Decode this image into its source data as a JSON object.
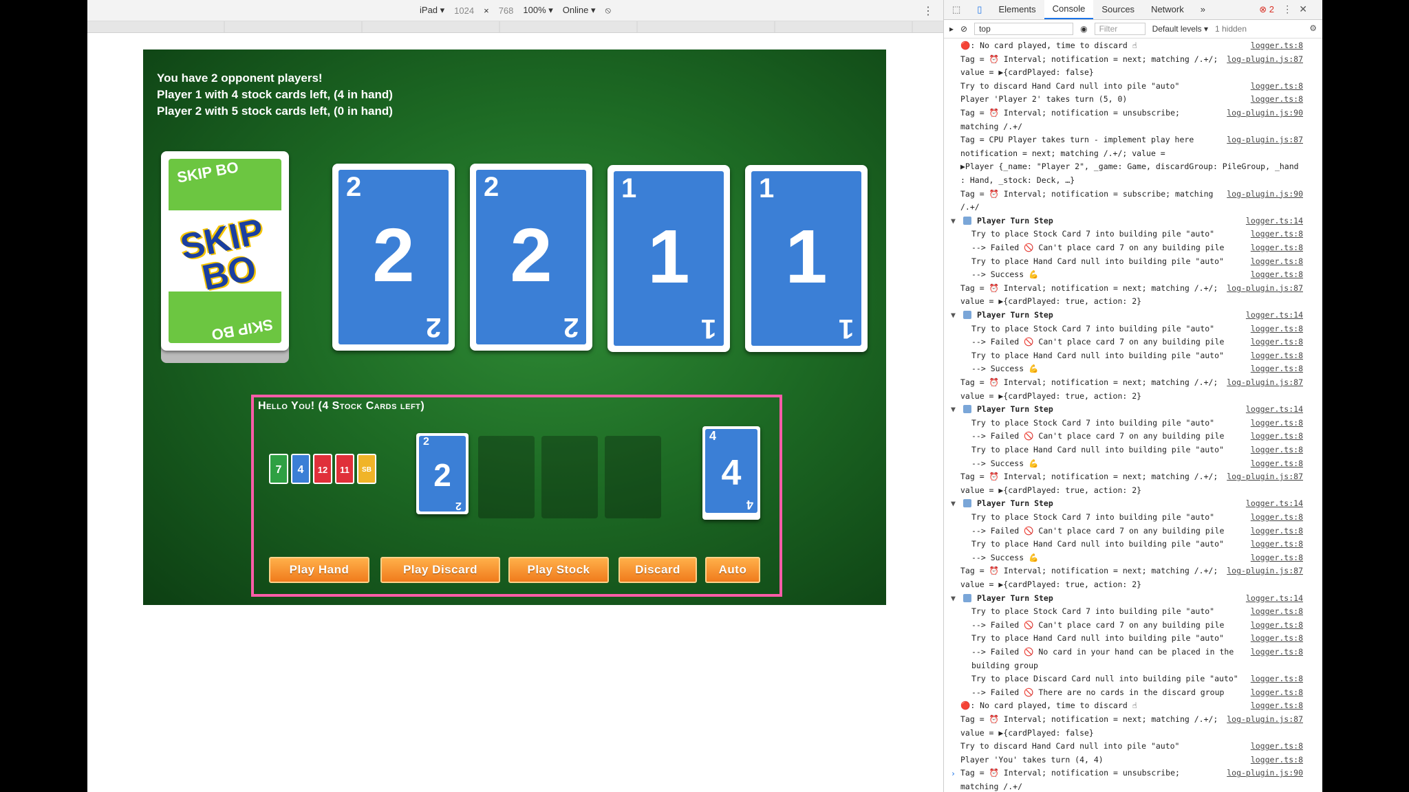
{
  "device_toolbar": {
    "device": "iPad ▾",
    "width": "1024",
    "times": "×",
    "height": "768",
    "zoom": "100% ▾",
    "network": "Online ▾"
  },
  "game": {
    "opponent_info": [
      "You have 2 opponent players!",
      "Player 1 with 4 stock cards left, (4 in hand)",
      "Player 2 with 5 stock cards left, (0 in hand)"
    ],
    "deck_logo": {
      "small": "SKIP BO",
      "big": "SKIP BO"
    },
    "building_piles": [
      "2",
      "2",
      "1",
      "1"
    ],
    "player": {
      "title": "Hello You! (4 Stock Cards left)",
      "hand": [
        {
          "value": "7",
          "color": "#2ea043"
        },
        {
          "value": "4",
          "color": "#3b7fd6"
        },
        {
          "value": "12",
          "color": "#e0303a"
        },
        {
          "value": "11",
          "color": "#e0303a"
        },
        {
          "value": "SB",
          "color": "#f0b429"
        }
      ],
      "discard_top": "2",
      "stock_top": "4",
      "buttons": [
        "Play Hand",
        "Play Discard",
        "Play Stock",
        "Discard",
        "Auto"
      ]
    }
  },
  "devtools": {
    "tabs": [
      "Elements",
      "Console",
      "Sources",
      "Network",
      "»"
    ],
    "error_count": "2",
    "context": "top",
    "filter_placeholder": "Filter",
    "levels": "Default levels ▾",
    "hidden": "1 hidden",
    "logs": [
      {
        "t": "msg",
        "m": "🔴: No card played, time to discard ☝",
        "s": "logger.ts:8"
      },
      {
        "t": "msg",
        "m": "Tag = ⏰ Interval; notification = next; matching /.+/;",
        "s": "log-plugin.js:87"
      },
      {
        "t": "msg",
        "m": "value = ▶{cardPlayed: false}",
        "s": ""
      },
      {
        "t": "msg",
        "m": "Try to discard Hand Card null into pile \"auto\"",
        "s": "logger.ts:8"
      },
      {
        "t": "msg",
        "m": "Player 'Player 2' takes turn (5, 0)",
        "s": "logger.ts:8"
      },
      {
        "t": "msg",
        "m": "Tag = ⏰ Interval; notification = unsubscribe;",
        "s": "log-plugin.js:90"
      },
      {
        "t": "msg",
        "m": "matching /.+/",
        "s": ""
      },
      {
        "t": "msg",
        "m": "Tag = CPU Player takes turn - implement play here",
        "s": "log-plugin.js:87"
      },
      {
        "t": "msg",
        "m": "notification = next; matching /.+/; value =",
        "s": ""
      },
      {
        "t": "msg",
        "m": "▶Player {_name: \"Player 2\", _game: Game, discardGroup: PileGroup, _hand",
        "s": ""
      },
      {
        "t": "msg",
        "m": ": Hand, _stock: Deck, …}",
        "s": ""
      },
      {
        "t": "msg",
        "m": "Tag = ⏰ Interval; notification = subscribe; matching",
        "s": "log-plugin.js:90"
      },
      {
        "t": "msg",
        "m": "/.+/",
        "s": ""
      },
      {
        "t": "group",
        "m": "Player Turn Step",
        "s": "logger.ts:14"
      },
      {
        "t": "indent",
        "m": "Try to place Stock Card 7 into building pile \"auto\"",
        "s": "logger.ts:8"
      },
      {
        "t": "indent",
        "m": "--> Failed 🚫 Can't place card 7 on any building pile",
        "s": "logger.ts:8"
      },
      {
        "t": "indent",
        "m": "Try to place Hand Card null into building pile \"auto\"",
        "s": "logger.ts:8"
      },
      {
        "t": "indent",
        "m": "--> Success 💪",
        "s": "logger.ts:8"
      },
      {
        "t": "msg",
        "m": "Tag = ⏰ Interval; notification = next; matching /.+/;",
        "s": "log-plugin.js:87"
      },
      {
        "t": "msg",
        "m": "value = ▶{cardPlayed: true, action: 2}",
        "s": ""
      },
      {
        "t": "group",
        "m": "Player Turn Step",
        "s": "logger.ts:14"
      },
      {
        "t": "indent",
        "m": "Try to place Stock Card 7 into building pile \"auto\"",
        "s": "logger.ts:8"
      },
      {
        "t": "indent",
        "m": "--> Failed 🚫 Can't place card 7 on any building pile",
        "s": "logger.ts:8"
      },
      {
        "t": "indent",
        "m": "Try to place Hand Card null into building pile \"auto\"",
        "s": "logger.ts:8"
      },
      {
        "t": "indent",
        "m": "--> Success 💪",
        "s": "logger.ts:8"
      },
      {
        "t": "msg",
        "m": "Tag = ⏰ Interval; notification = next; matching /.+/;",
        "s": "log-plugin.js:87"
      },
      {
        "t": "msg",
        "m": "value = ▶{cardPlayed: true, action: 2}",
        "s": ""
      },
      {
        "t": "group",
        "m": "Player Turn Step",
        "s": "logger.ts:14"
      },
      {
        "t": "indent",
        "m": "Try to place Stock Card 7 into building pile \"auto\"",
        "s": "logger.ts:8"
      },
      {
        "t": "indent",
        "m": "--> Failed 🚫 Can't place card 7 on any building pile",
        "s": "logger.ts:8"
      },
      {
        "t": "indent",
        "m": "Try to place Hand Card null into building pile \"auto\"",
        "s": "logger.ts:8"
      },
      {
        "t": "indent",
        "m": "--> Success 💪",
        "s": "logger.ts:8"
      },
      {
        "t": "msg",
        "m": "Tag = ⏰ Interval; notification = next; matching /.+/;",
        "s": "log-plugin.js:87"
      },
      {
        "t": "msg",
        "m": "value = ▶{cardPlayed: true, action: 2}",
        "s": ""
      },
      {
        "t": "group",
        "m": "Player Turn Step",
        "s": "logger.ts:14"
      },
      {
        "t": "indent",
        "m": "Try to place Stock Card 7 into building pile \"auto\"",
        "s": "logger.ts:8"
      },
      {
        "t": "indent",
        "m": "--> Failed 🚫 Can't place card 7 on any building pile",
        "s": "logger.ts:8"
      },
      {
        "t": "indent",
        "m": "Try to place Hand Card null into building pile \"auto\"",
        "s": "logger.ts:8"
      },
      {
        "t": "indent",
        "m": "--> Success 💪",
        "s": "logger.ts:8"
      },
      {
        "t": "msg",
        "m": "Tag = ⏰ Interval; notification = next; matching /.+/;",
        "s": "log-plugin.js:87"
      },
      {
        "t": "msg",
        "m": "value = ▶{cardPlayed: true, action: 2}",
        "s": ""
      },
      {
        "t": "group",
        "m": "Player Turn Step",
        "s": "logger.ts:14"
      },
      {
        "t": "indent",
        "m": "Try to place Stock Card 7 into building pile \"auto\"",
        "s": "logger.ts:8"
      },
      {
        "t": "indent",
        "m": "--> Failed 🚫 Can't place card 7 on any building pile",
        "s": "logger.ts:8"
      },
      {
        "t": "indent",
        "m": "Try to place Hand Card null into building pile \"auto\"",
        "s": "logger.ts:8"
      },
      {
        "t": "indent",
        "m": "--> Failed 🚫 No card in your hand can be placed in the",
        "s": "logger.ts:8"
      },
      {
        "t": "indent",
        "m": "building group",
        "s": ""
      },
      {
        "t": "indent",
        "m": "Try to place Discard Card null into building pile \"auto\"",
        "s": "logger.ts:8"
      },
      {
        "t": "indent",
        "m": "--> Failed 🚫 There are no cards in the discard group",
        "s": "logger.ts:8"
      },
      {
        "t": "msg",
        "m": "🔴: No card played, time to discard ☝",
        "s": "logger.ts:8"
      },
      {
        "t": "msg",
        "m": "Tag = ⏰ Interval; notification = next; matching /.+/;",
        "s": "log-plugin.js:87"
      },
      {
        "t": "msg",
        "m": "value = ▶{cardPlayed: false}",
        "s": ""
      },
      {
        "t": "msg",
        "m": "Try to discard Hand Card null into pile \"auto\"",
        "s": "logger.ts:8"
      },
      {
        "t": "msg",
        "m": "Player 'You' takes turn (4, 4)",
        "s": "logger.ts:8"
      },
      {
        "t": "msg",
        "m": "Tag = ⏰ Interval; notification = unsubscribe;",
        "s": "log-plugin.js:90"
      },
      {
        "t": "msg",
        "m": "matching /.+/",
        "s": ""
      }
    ],
    "prompt": "›"
  }
}
